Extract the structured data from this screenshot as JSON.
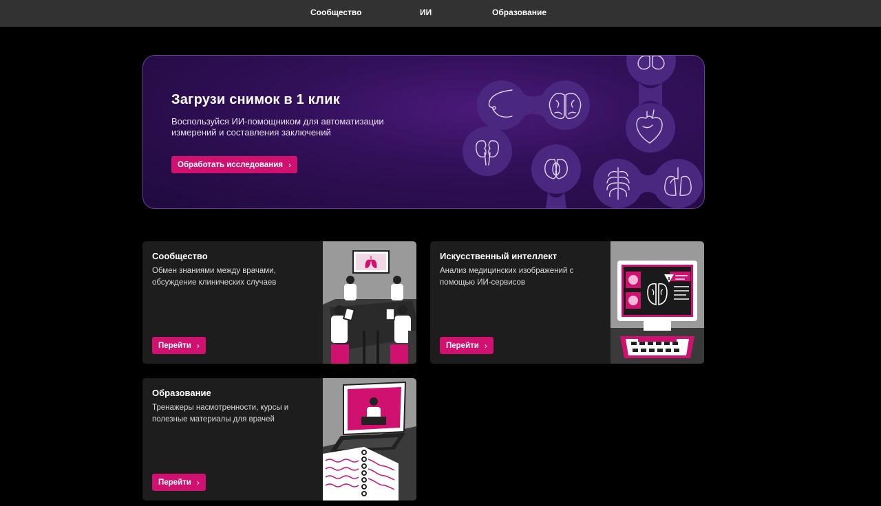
{
  "nav": {
    "items": [
      "Сообщество",
      "ИИ",
      "Образование"
    ]
  },
  "hero": {
    "title": "Загрузи снимок в 1 клик",
    "description": "Воспользуйся ИИ-помощником для автоматизации измерений и составления заключений",
    "button_label": "Обработать исследования",
    "organ_icons": [
      "breast-icon",
      "brain-icon",
      "heart-icon",
      "kidney-icon",
      "brain-icon",
      "ribcage-icon",
      "lungs-icon"
    ]
  },
  "cards": [
    {
      "title": "Сообщество",
      "description": "Обмен знаниями между врачами, обсуждение клинических случаев",
      "button_label": "Перейти"
    },
    {
      "title": "Искусственный интеллект",
      "description": "Анализ медицинских изображений с помощью ИИ-сервисов",
      "button_label": "Перейти"
    },
    {
      "title": "Образование",
      "description": "Тренажеры насмотренности, курсы и полезные материалы для врачей",
      "button_label": "Перейти"
    }
  ],
  "colors": {
    "accent": "#d0116f",
    "topbar": "#323232",
    "card": "#1d1d1d",
    "hero": "#321059"
  }
}
